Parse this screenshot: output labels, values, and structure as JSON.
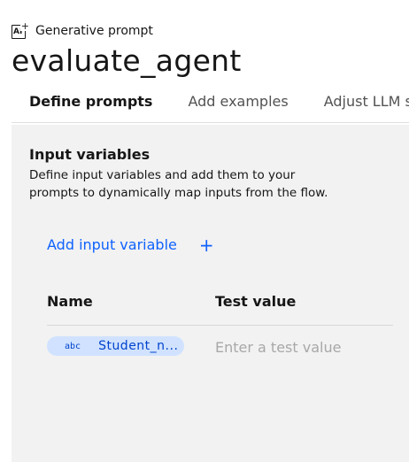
{
  "header": {
    "icon_label": "AI",
    "type_label": "Generative prompt",
    "title": "evaluate_agent"
  },
  "tabs": [
    {
      "label": "Define prompts",
      "active": true
    },
    {
      "label": "Add examples",
      "active": false
    },
    {
      "label": "Adjust LLM settings",
      "active": false
    }
  ],
  "input_variables": {
    "title": "Input variables",
    "description": "Define input variables and add them to your prompts to dynamically map inputs from the flow.",
    "add_label": "Add input variable",
    "add_icon": "+",
    "columns": {
      "name": "Name",
      "test_value": "Test value"
    },
    "rows": [
      {
        "type_icon": "abc",
        "name": "Student_n...",
        "test_placeholder": "Enter a test value"
      }
    ]
  },
  "colors": {
    "accent": "#0f62fe",
    "tag_bg": "#d0e2ff",
    "tag_text": "#0043ce",
    "panel_bg": "#f2f2f2"
  }
}
